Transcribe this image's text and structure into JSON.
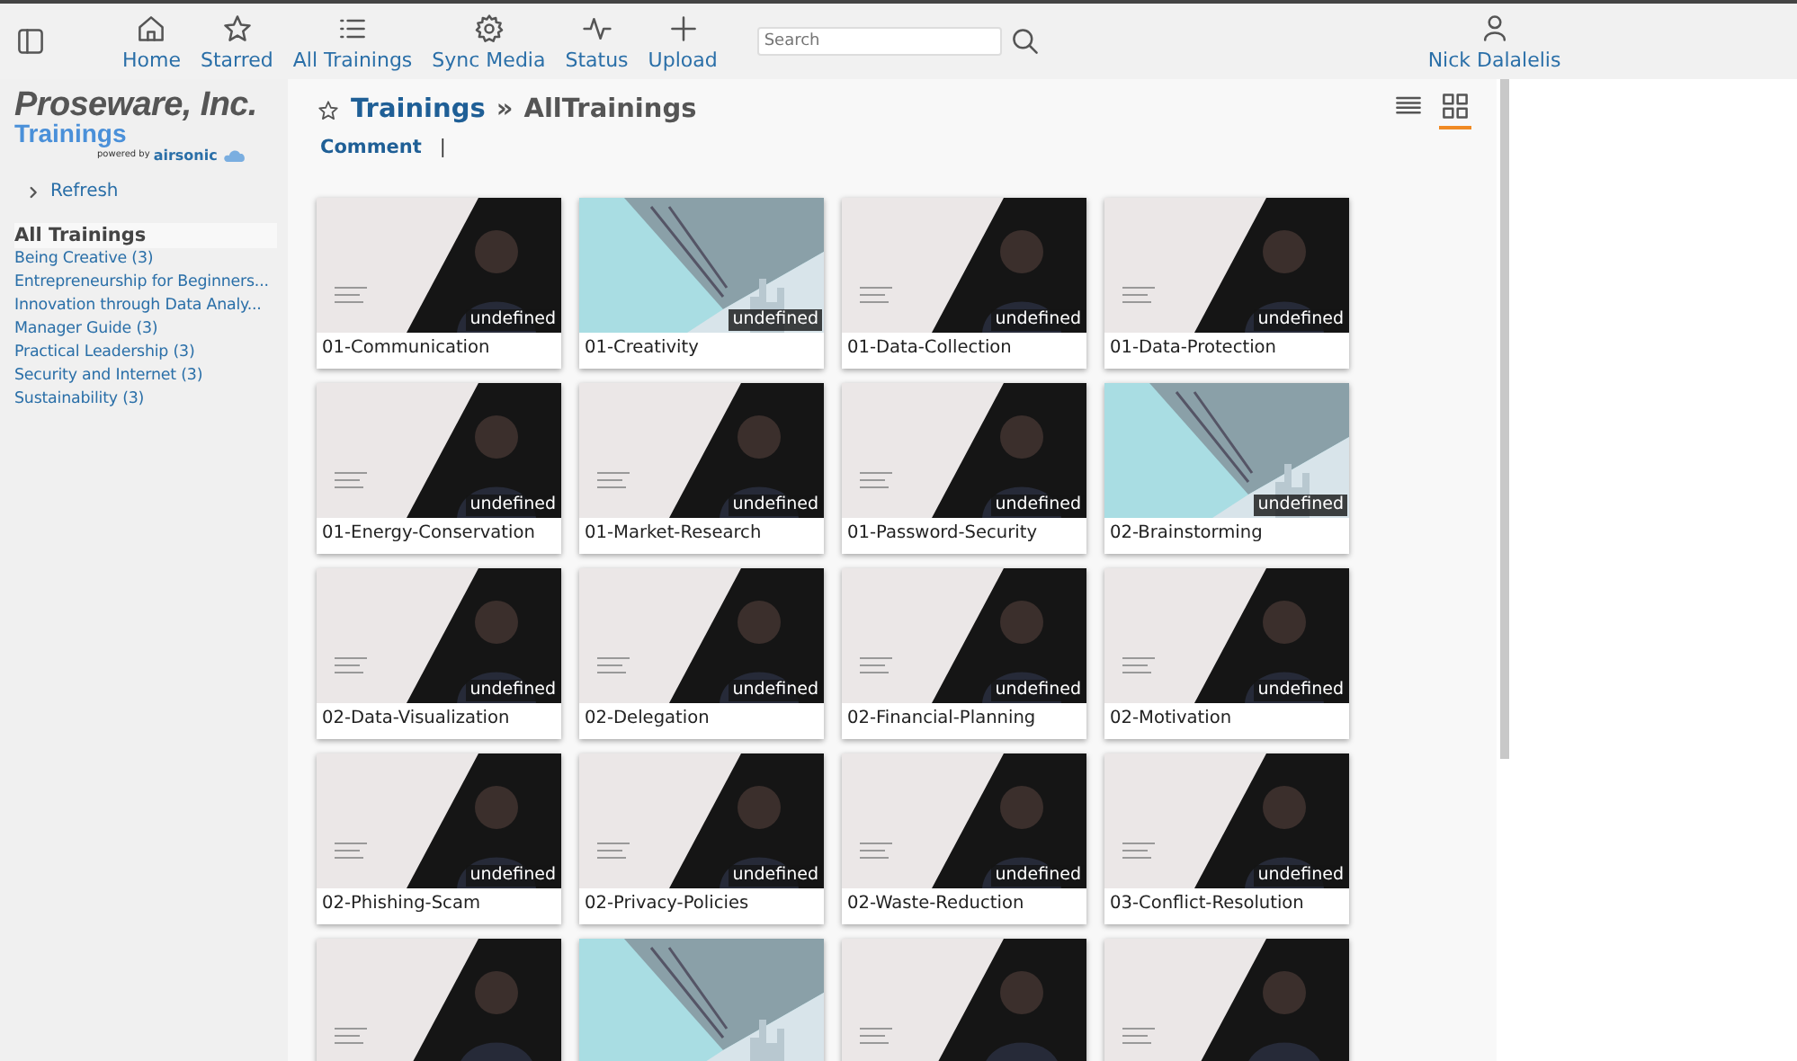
{
  "nav": [
    {
      "label": "Home"
    },
    {
      "label": "Starred"
    },
    {
      "label": "All Trainings"
    },
    {
      "label": "Sync Media"
    },
    {
      "label": "Status"
    },
    {
      "label": "Upload"
    }
  ],
  "search": {
    "placeholder": "Search"
  },
  "user": {
    "name": "Nick Dalalelis"
  },
  "logo": {
    "company": "Proseware, Inc.",
    "product": "Trainings",
    "powered_by": "powered by",
    "brand": "airsonic"
  },
  "sidebar": {
    "refresh": "Refresh",
    "heading": "All Trainings",
    "items": [
      "Being Creative (3)",
      "Entrepreneurship for Beginners...",
      "Innovation through Data Analy...",
      "Manager Guide (3)",
      "Practical Leadership (3)",
      "Security and Internet (3)",
      "Sustainability (3)"
    ]
  },
  "breadcrumb": {
    "root": "Trainings",
    "separator": "»",
    "current": "AllTrainings"
  },
  "actions": {
    "comment": "Comment",
    "divider": "|"
  },
  "views": [
    {
      "kind": "list",
      "selected": false
    },
    {
      "kind": "grid",
      "selected": true
    }
  ],
  "cards": [
    {
      "title": "01-Communication",
      "badge": "undefined",
      "kind": "presenter"
    },
    {
      "title": "01-Creativity",
      "badge": "undefined",
      "kind": "cityscape"
    },
    {
      "title": "01-Data-Collection",
      "badge": "undefined",
      "kind": "presenter"
    },
    {
      "title": "01-Data-Protection",
      "badge": "undefined",
      "kind": "presenter"
    },
    {
      "title": "01-Energy-Conservation",
      "badge": "undefined",
      "kind": "presenter"
    },
    {
      "title": "01-Market-Research",
      "badge": "undefined",
      "kind": "presenter"
    },
    {
      "title": "01-Password-Security",
      "badge": "undefined",
      "kind": "presenter"
    },
    {
      "title": "02-Brainstorming",
      "badge": "undefined",
      "kind": "cityscape"
    },
    {
      "title": "02-Data-Visualization",
      "badge": "undefined",
      "kind": "presenter"
    },
    {
      "title": "02-Delegation",
      "badge": "undefined",
      "kind": "presenter"
    },
    {
      "title": "02-Financial-Planning",
      "badge": "undefined",
      "kind": "presenter"
    },
    {
      "title": "02-Motivation",
      "badge": "undefined",
      "kind": "presenter"
    },
    {
      "title": "02-Phishing-Scam",
      "badge": "undefined",
      "kind": "presenter"
    },
    {
      "title": "02-Privacy-Policies",
      "badge": "undefined",
      "kind": "presenter"
    },
    {
      "title": "02-Waste-Reduction",
      "badge": "undefined",
      "kind": "presenter"
    },
    {
      "title": "03-Conflict-Resolution",
      "badge": "undefined",
      "kind": "presenter"
    },
    {
      "kind": "presenter"
    },
    {
      "kind": "cityscape"
    },
    {
      "kind": "presenter"
    },
    {
      "kind": "presenter"
    }
  ]
}
